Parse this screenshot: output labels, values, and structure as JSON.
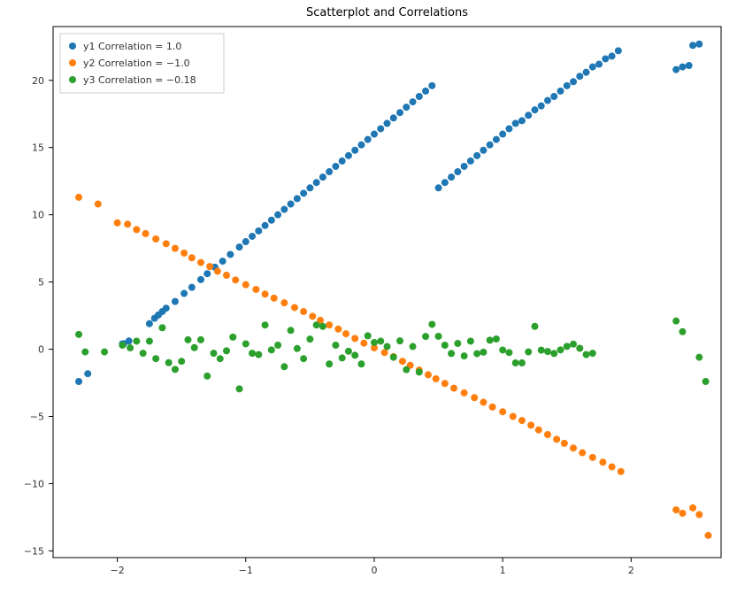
{
  "chart_data": {
    "type": "scatter",
    "title": "Scatterplot and Correlations",
    "xlabel": "",
    "ylabel": "",
    "xlim": [
      -2.5,
      2.7
    ],
    "ylim": [
      -15.5,
      24
    ],
    "xticks": [
      -2,
      -1,
      0,
      1,
      2
    ],
    "yticks": [
      -15,
      -10,
      -5,
      0,
      5,
      10,
      15,
      20
    ],
    "legend_position": "upper-left",
    "series": [
      {
        "name": "y1 Correlation = 1.0",
        "color": "#1f77b4",
        "x": [
          -2.3,
          -2.23,
          -1.96,
          -1.95,
          -1.91,
          -1.75,
          -1.71,
          -1.68,
          -1.65,
          -1.62,
          -1.55,
          -1.48,
          -1.42,
          -1.35,
          -1.3,
          -1.24,
          -1.18,
          -1.12,
          -1.05,
          -1.0,
          -0.95,
          -0.9,
          -0.85,
          -0.8,
          -0.75,
          -0.7,
          -0.65,
          -0.6,
          -0.55,
          -0.5,
          -0.45,
          -0.4,
          -0.35,
          -0.3,
          -0.25,
          -0.2,
          -0.15,
          -0.1,
          -0.05,
          0.0,
          0.05,
          0.1,
          0.15,
          0.2,
          0.25,
          0.3,
          0.35,
          0.4,
          0.45,
          0.5,
          0.55,
          0.6,
          0.65,
          0.7,
          0.75,
          0.8,
          0.85,
          0.9,
          0.95,
          1.0,
          1.05,
          1.1,
          1.15,
          1.2,
          1.25,
          1.3,
          1.35,
          1.4,
          1.45,
          1.5,
          1.55,
          1.6,
          1.65,
          1.7,
          1.75,
          1.8,
          1.85,
          1.9,
          2.35,
          2.4,
          2.45,
          2.48,
          2.53
        ],
        "y": [
          -2.4,
          -1.82,
          0.4,
          0.41,
          0.61,
          1.9,
          2.3,
          2.55,
          2.8,
          3.05,
          3.55,
          4.15,
          4.6,
          5.18,
          5.62,
          6.1,
          6.55,
          7.05,
          7.6,
          8.0,
          8.4,
          8.8,
          9.2,
          9.6,
          10.0,
          10.4,
          10.8,
          11.2,
          11.6,
          12.0,
          12.4,
          12.8,
          13.2,
          13.6,
          14.0,
          14.4,
          14.8,
          15.2,
          15.6,
          16.0,
          16.4,
          16.8,
          17.2,
          17.6,
          18.0,
          18.4,
          18.8,
          19.2,
          19.6,
          12.0,
          12.4,
          12.8,
          13.2,
          13.6,
          14.0,
          14.4,
          14.8,
          15.2,
          15.6,
          16.0,
          16.4,
          16.8,
          17.0,
          17.4,
          17.8,
          18.1,
          18.5,
          18.8,
          19.2,
          19.6,
          19.9,
          20.3,
          20.6,
          21.0,
          21.2,
          21.6,
          21.8,
          22.2,
          20.8,
          21.0,
          21.1,
          22.6,
          22.7
        ]
      },
      {
        "name": "y2 Correlation = -1.0",
        "color": "#ff7f0e",
        "x": [
          -2.3,
          -2.15,
          -2.0,
          -1.92,
          -1.85,
          -1.78,
          -1.7,
          -1.62,
          -1.55,
          -1.48,
          -1.42,
          -1.35,
          -1.28,
          -1.22,
          -1.15,
          -1.08,
          -1.0,
          -0.92,
          -0.85,
          -0.78,
          -0.7,
          -0.62,
          -0.55,
          -0.48,
          -0.42,
          -0.35,
          -0.28,
          -0.22,
          -0.15,
          -0.08,
          0.0,
          0.08,
          0.15,
          0.22,
          0.28,
          0.35,
          0.42,
          0.48,
          0.55,
          0.62,
          0.7,
          0.78,
          0.85,
          0.92,
          1.0,
          1.08,
          1.15,
          1.22,
          1.28,
          1.35,
          1.42,
          1.48,
          1.55,
          1.62,
          1.7,
          1.78,
          1.85,
          1.92,
          2.35,
          2.4,
          2.48,
          2.53,
          2.6
        ],
        "y": [
          11.3,
          10.8,
          9.4,
          9.3,
          8.9,
          8.6,
          8.2,
          7.85,
          7.5,
          7.15,
          6.8,
          6.45,
          6.15,
          5.8,
          5.5,
          5.15,
          4.8,
          4.45,
          4.1,
          3.8,
          3.45,
          3.1,
          2.8,
          2.45,
          2.15,
          1.8,
          1.5,
          1.15,
          0.8,
          0.45,
          0.1,
          -0.25,
          -0.55,
          -0.9,
          -1.2,
          -1.55,
          -1.9,
          -2.2,
          -2.55,
          -2.9,
          -3.25,
          -3.6,
          -3.95,
          -4.3,
          -4.65,
          -5.0,
          -5.3,
          -5.65,
          -6.0,
          -6.35,
          -6.7,
          -7.0,
          -7.35,
          -7.7,
          -8.05,
          -8.4,
          -8.75,
          -9.1,
          -11.95,
          -12.2,
          -11.8,
          -12.3,
          -13.85
        ]
      },
      {
        "name": "y3 Correlation = -0.18",
        "color": "#2ca02c",
        "x": [
          -2.3,
          -2.25,
          -2.1,
          -1.96,
          -1.9,
          -1.85,
          -1.8,
          -1.75,
          -1.7,
          -1.65,
          -1.6,
          -1.55,
          -1.5,
          -1.45,
          -1.4,
          -1.35,
          -1.3,
          -1.25,
          -1.2,
          -1.15,
          -1.1,
          -1.05,
          -1.0,
          -0.95,
          -0.9,
          -0.85,
          -0.8,
          -0.75,
          -0.7,
          -0.65,
          -0.6,
          -0.55,
          -0.5,
          -0.45,
          -0.4,
          -0.35,
          -0.3,
          -0.25,
          -0.2,
          -0.15,
          -0.1,
          -0.05,
          0.0,
          0.05,
          0.1,
          0.15,
          0.2,
          0.25,
          0.3,
          0.35,
          0.4,
          0.45,
          0.5,
          0.55,
          0.6,
          0.65,
          0.7,
          0.75,
          0.8,
          0.85,
          0.9,
          0.95,
          1.0,
          1.05,
          1.1,
          1.15,
          1.2,
          1.25,
          1.3,
          1.35,
          1.4,
          1.45,
          1.5,
          1.55,
          1.6,
          1.65,
          1.7,
          2.35,
          2.4,
          2.53,
          2.58
        ],
        "y": [
          1.1,
          -0.2,
          -0.2,
          0.3,
          0.1,
          0.6,
          -0.3,
          0.6,
          -0.7,
          1.6,
          -1.0,
          -1.5,
          -0.9,
          0.7,
          0.12,
          0.7,
          -2.0,
          -0.3,
          -0.7,
          -0.12,
          0.9,
          -2.95,
          0.4,
          -0.3,
          -0.4,
          1.8,
          -0.05,
          0.3,
          -1.3,
          1.4,
          0.05,
          -0.7,
          0.75,
          1.8,
          1.7,
          -1.1,
          0.3,
          -0.65,
          -0.15,
          -0.45,
          -1.1,
          1.0,
          0.5,
          0.6,
          0.2,
          -0.6,
          0.62,
          -1.52,
          0.2,
          -1.7,
          0.95,
          1.85,
          0.96,
          0.3,
          -0.32,
          0.43,
          -0.5,
          0.6,
          -0.33,
          -0.22,
          0.67,
          0.76,
          -0.06,
          -0.25,
          -1.02,
          -1.02,
          -0.2,
          1.7,
          -0.07,
          -0.17,
          -0.32,
          -0.05,
          0.21,
          0.38,
          0.07,
          -0.4,
          -0.3,
          2.1,
          1.3,
          -0.6,
          -2.4
        ]
      }
    ]
  }
}
